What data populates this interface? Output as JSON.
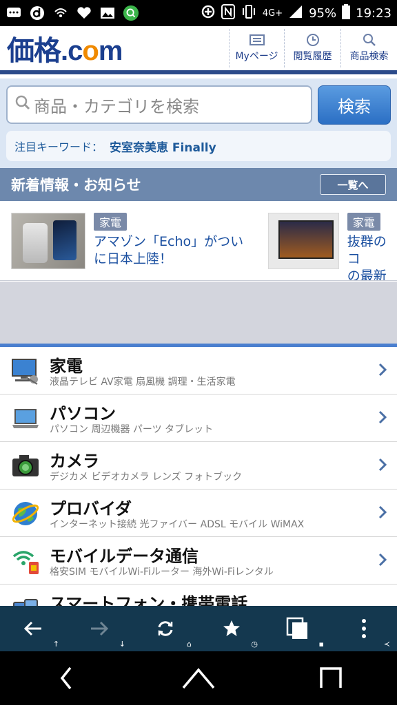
{
  "status_bar": {
    "network": "4G+",
    "battery": "95%",
    "time": "19:23"
  },
  "header": {
    "logo_kakaku": "価格",
    "logo_dot": ".",
    "logo_c": "c",
    "logo_o": "o",
    "logo_m": "m",
    "nav": [
      {
        "label": "Myページ",
        "icon": "mypage-icon"
      },
      {
        "label": "閲覧履歴",
        "icon": "history-clock-icon"
      },
      {
        "label": "商品検索",
        "icon": "search-icon"
      }
    ]
  },
  "search": {
    "placeholder": "商品・カテゴリを検索",
    "button": "検索",
    "keyword_label": "注目キーワード：",
    "keyword_value": "安室奈美恵 Finally"
  },
  "news": {
    "title": "新着情報・お知らせ",
    "more": "一覧へ",
    "items": [
      {
        "tag": "家電",
        "title_line1": "アマゾン「Echo」がつい",
        "title_line2": "に日本上陸！"
      },
      {
        "tag": "家電",
        "title_line1": "抜群のコ",
        "title_line2": "の最新派"
      }
    ]
  },
  "categories": [
    {
      "name": "家電",
      "sub": "液晶テレビ AV家電 扇風機 調理・生活家電",
      "icon": "home-appliance-icon"
    },
    {
      "name": "パソコン",
      "sub": "パソコン 周辺機器 パーツ タブレット",
      "icon": "laptop-icon"
    },
    {
      "name": "カメラ",
      "sub": "デジカメ ビデオカメラ レンズ フォトブック",
      "icon": "camera-icon"
    },
    {
      "name": "プロバイダ",
      "sub": "インターネット接続 光ファイバー ADSL モバイル WiMAX",
      "icon": "globe-icon"
    },
    {
      "name": "モバイルデータ通信",
      "sub": "格安SIM モバイルWi-Fiルーター 海外Wi-Fiレンタル",
      "icon": "wifi-sim-icon"
    },
    {
      "name": "スマートフォン・携帯電話",
      "sub": "",
      "icon": "smartphone-icon"
    }
  ],
  "colors": {
    "brand_navy": "#1b3f8f",
    "brand_orange": "#f08a00",
    "toolbar": "#14384f"
  }
}
